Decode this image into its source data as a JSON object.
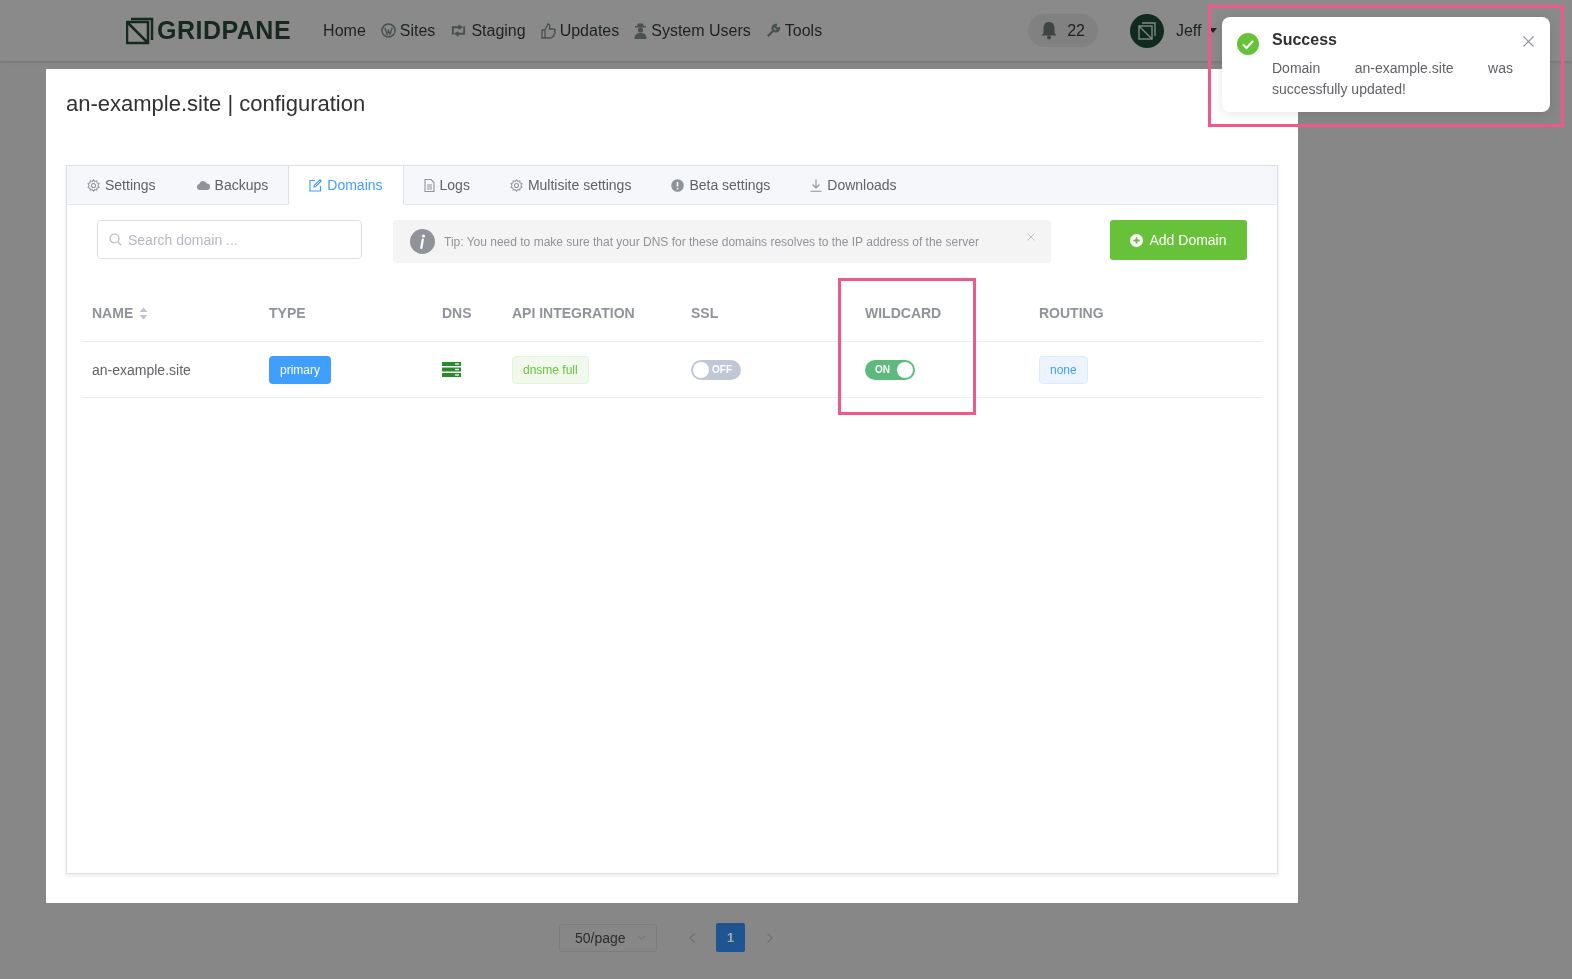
{
  "header": {
    "logo": "GRIDPANE",
    "nav": [
      {
        "label": "Home"
      },
      {
        "label": "Sites"
      },
      {
        "label": "Staging"
      },
      {
        "label": "Updates"
      },
      {
        "label": "System Users"
      },
      {
        "label": "Tools"
      }
    ],
    "notifications": {
      "count": "22"
    },
    "user": {
      "name": "Jeff"
    }
  },
  "modal": {
    "title": "an-example.site | configuration",
    "tabs": [
      {
        "label": "Settings",
        "selected": false
      },
      {
        "label": "Backups",
        "selected": false
      },
      {
        "label": "Domains",
        "selected": true
      },
      {
        "label": "Logs",
        "selected": false
      },
      {
        "label": "Multisite settings",
        "selected": false
      },
      {
        "label": "Beta settings",
        "selected": false
      },
      {
        "label": "Downloads",
        "selected": false
      }
    ],
    "search": {
      "placeholder": "Search domain ..."
    },
    "tip": {
      "text": "Tip: You need to make sure that your DNS for these domains resolves to the IP address of the server"
    },
    "add_button": "Add Domain",
    "table": {
      "columns": [
        "NAME",
        "TYPE",
        "DNS",
        "API INTEGRATION",
        "SSL",
        "WILDCARD",
        "ROUTING"
      ],
      "rows": [
        {
          "name": "an-example.site",
          "type": "primary",
          "api_integration": "dnsme full",
          "ssl": {
            "on": false,
            "label": "OFF"
          },
          "wildcard": {
            "on": true,
            "label": "ON"
          },
          "routing": "none"
        }
      ]
    }
  },
  "pagination": {
    "page_size": "50/page",
    "pages": [
      {
        "label": "1",
        "selected": true
      }
    ]
  },
  "toast": {
    "title": "Success",
    "message": "Domain an-example.site was successfully updated!"
  }
}
